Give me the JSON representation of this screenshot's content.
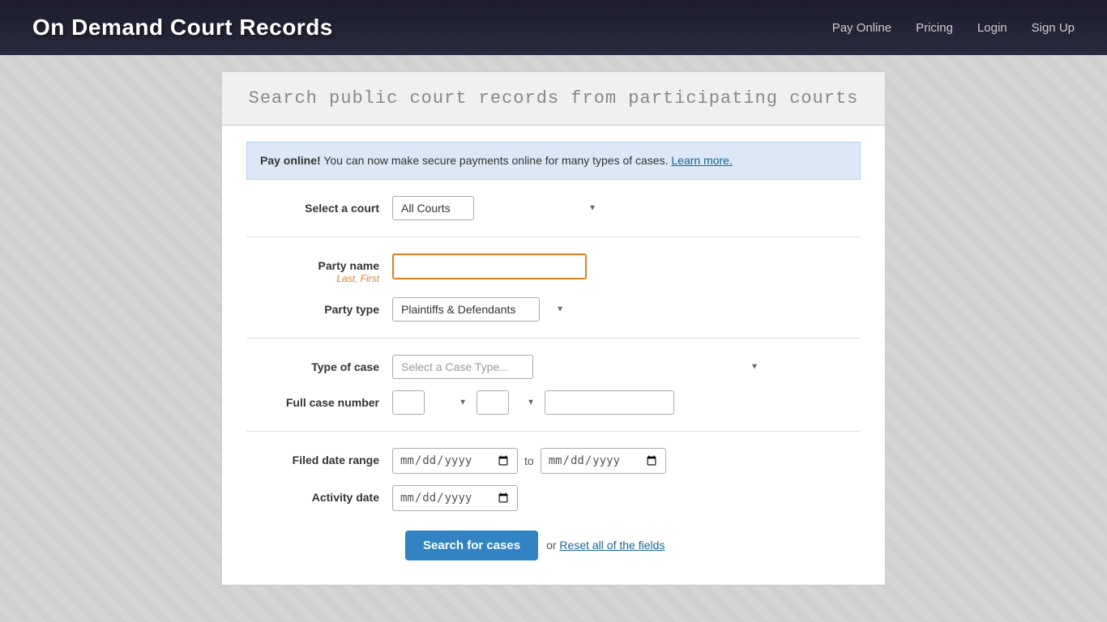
{
  "header": {
    "logo": "On Demand Court Records",
    "nav": {
      "pay_online": "Pay Online",
      "pricing": "Pricing",
      "login": "Login",
      "sign_up": "Sign Up"
    }
  },
  "page": {
    "title": "Search public court records from participating courts"
  },
  "alert": {
    "bold_text": "Pay online!",
    "message": " You can now make secure payments online for many types of cases.",
    "link_text": "Learn more."
  },
  "form": {
    "select_court_label": "Select a court",
    "select_court_default": "All Courts",
    "party_name_label": "Party name",
    "party_name_sublabel": "Last, First",
    "party_type_label": "Party type",
    "party_type_default": "Plaintiffs & Defendants",
    "type_of_case_label": "Type of case",
    "type_of_case_placeholder": "Select a Case Type...",
    "full_case_number_label": "Full case number",
    "filed_date_label": "Filed date range",
    "to_text": "to",
    "activity_date_label": "Activity date",
    "search_button": "Search for cases",
    "reset_text": "or",
    "reset_link": "Reset all of the fields",
    "date_placeholder": "mm/dd/yyyy"
  }
}
